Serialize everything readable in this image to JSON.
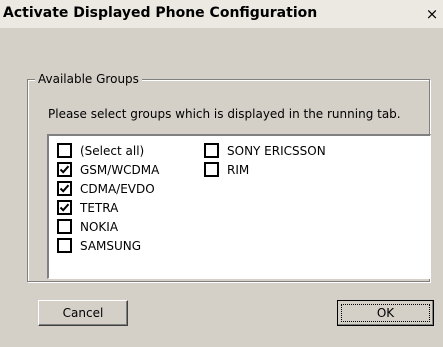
{
  "window": {
    "title": "Activate Displayed Phone Configuration",
    "close_symbol": "×"
  },
  "group": {
    "legend": "Available Groups",
    "instruction": "Please select groups which is displayed in the running tab."
  },
  "items_col1": [
    {
      "label": "(Select all)",
      "checked": false
    },
    {
      "label": "GSM/WCDMA",
      "checked": true
    },
    {
      "label": "CDMA/EVDO",
      "checked": true
    },
    {
      "label": "TETRA",
      "checked": true
    },
    {
      "label": "NOKIA",
      "checked": false
    },
    {
      "label": "SAMSUNG",
      "checked": false
    }
  ],
  "items_col2": [
    {
      "label": "SONY ERICSSON",
      "checked": false
    },
    {
      "label": "RIM",
      "checked": false
    }
  ],
  "buttons": {
    "cancel": "Cancel",
    "ok": "OK"
  }
}
